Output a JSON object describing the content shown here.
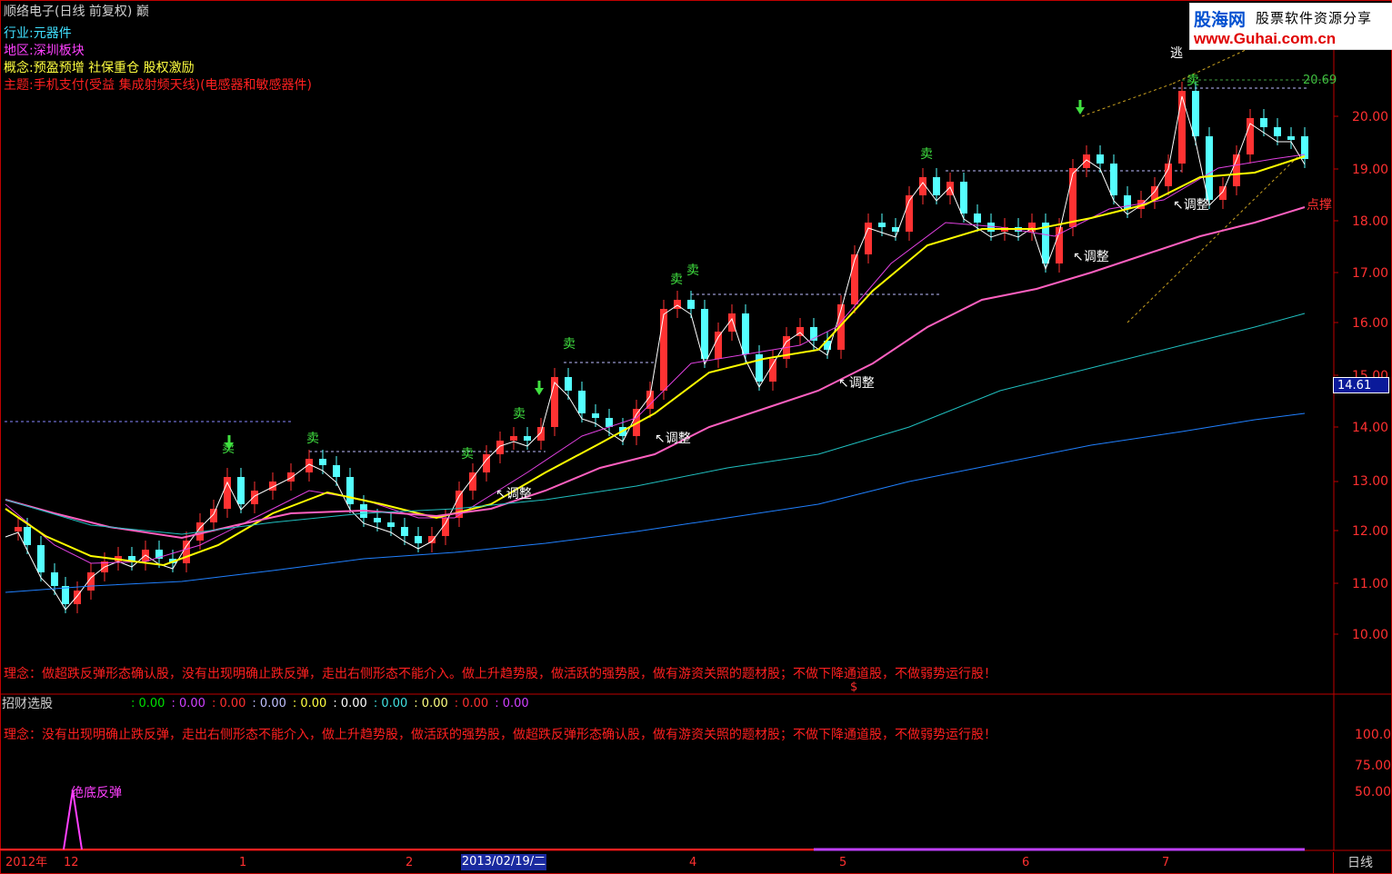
{
  "header": {
    "title": "顺络电子(日线 前复权) 巅",
    "industry_label": "行业:",
    "industry_value": "元器件",
    "region_label": "地区:",
    "region_value": "深圳板块",
    "concept_label": "概念:",
    "concept_value": "预盈预增 社保重仓 股权激励",
    "theme_label": "主题:",
    "theme_value": "手机支付(受益 集成射频天线)(电感器和敏感器件)"
  },
  "logo": {
    "name": "股海网",
    "slogan": "股票软件资源分享",
    "url": "www.Guhai.com.cn"
  },
  "main_panel": {
    "escape_label": "逃",
    "top_level_label": "20.69",
    "stop_label": "点撑",
    "current_price": "14.61",
    "philosophy_text": "理念：做超跌反弹形态确认股，没有出现明确止跌反弹，走出右侧形态不能介入。做上升趋势股，做活跃的强势股，做有游资关照的题材股；不做下降通道股，不做弱势运行股！",
    "dollar_marker": "$",
    "y_axis_ticks": [
      "20.00",
      "19.00",
      "18.00",
      "17.00",
      "16.00",
      "15.00",
      "14.00",
      "13.00",
      "12.00",
      "11.00",
      "10.00"
    ],
    "sell_signal_label": "卖",
    "adjust_label": "↖调整"
  },
  "indicator_panel": {
    "name": "招财选股",
    "values": [
      {
        "text": ": 0.00",
        "color": "#00e000"
      },
      {
        "text": ": 0.00",
        "color": "#d040ff"
      },
      {
        "text": ": 0.00",
        "color": "#ff3030"
      },
      {
        "text": ": 0.00",
        "color": "#c0c0ff"
      },
      {
        "text": ": 0.00",
        "color": "#ffff40"
      },
      {
        "text": ": 0.00",
        "color": "#ffffff"
      },
      {
        "text": ": 0.00",
        "color": "#40e0e0"
      },
      {
        "text": ": 0.00",
        "color": "#ffff80"
      },
      {
        "text": ": 0.00",
        "color": "#ff3030"
      },
      {
        "text": ": 0.00",
        "color": "#d040ff"
      }
    ],
    "philosophy_text": "理念：没有出现明确止跌反弹，走出右侧形态不能介入，做上升趋势股，做活跃的强势股，做超跌反弹形态确认股，做有游资关照的题材股；不做下降通道股，不做弱势运行股！",
    "signal_label": "绝底反弹",
    "y_axis_ticks": [
      "100.0",
      "75.00",
      "50.00"
    ]
  },
  "time_axis": {
    "labels": [
      "2012年",
      "12",
      "1",
      "2",
      "4",
      "5",
      "6",
      "7"
    ],
    "selected_date": "2013/02/19/二",
    "period_button": "日线"
  },
  "colors": {
    "up": "#ff3232",
    "down": "#54ffff",
    "axis": "#c00000",
    "ma_yellow": "#ffff00",
    "ma_pink": "#ff60c0",
    "ma_cyan": "#20c0c0",
    "ma_blue": "#2080ff"
  }
}
